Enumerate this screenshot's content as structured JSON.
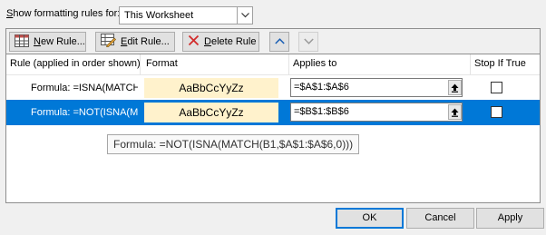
{
  "top": {
    "show_label": "Show formatting rules for:",
    "scope_value": "This Worksheet"
  },
  "toolbar": {
    "new_label": "New Rule...",
    "edit_label": "Edit Rule...",
    "delete_label": "Delete Rule"
  },
  "grid": {
    "headers": {
      "rule": "Rule (applied in order shown)",
      "format": "Format",
      "applies": "Applies to",
      "stop": "Stop If True"
    },
    "rows": [
      {
        "rule": "Formula: =ISNA(MATCH(...",
        "format_preview": "AaBbCcYyZz",
        "applies": "=$A$1:$A$6",
        "stop_if_true": false
      },
      {
        "rule": "Formula: =NOT(ISNA(M...",
        "format_preview": "AaBbCcYyZz",
        "applies": "=$B$1:$B$6",
        "stop_if_true": false
      }
    ]
  },
  "tooltip": "Formula: =NOT(ISNA(MATCH(B1,$A$1:$A$6,0)))",
  "buttons": {
    "ok": "OK",
    "cancel": "Cancel",
    "apply": "Apply"
  },
  "colors": {
    "selection": "#0078d7",
    "format_fill": "#fff2cc",
    "delete_icon": "#d22b2b"
  }
}
